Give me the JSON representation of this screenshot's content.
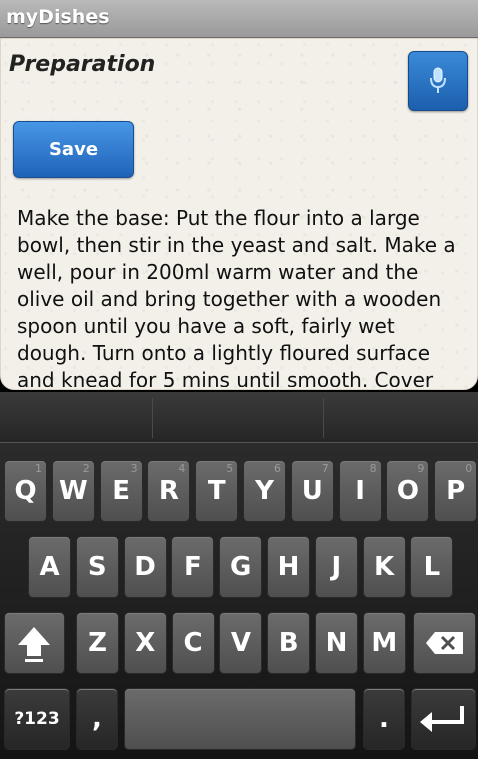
{
  "app": {
    "title": "myDishes"
  },
  "card": {
    "heading": "Preparation",
    "save_label": "Save",
    "text": "Make the base: Put the flour into a large bowl, then stir in the yeast and salt. Make a well, pour in 200ml warm water and the olive oil and bring together with a wooden spoon until you have a soft, fairly wet dough. Turn onto a lightly floured surface and knead for 5 mins until smooth. Cover"
  },
  "keyboard": {
    "row1": [
      {
        "label": "Q",
        "hint": "1"
      },
      {
        "label": "W",
        "hint": "2"
      },
      {
        "label": "E",
        "hint": "3"
      },
      {
        "label": "R",
        "hint": "4"
      },
      {
        "label": "T",
        "hint": "5"
      },
      {
        "label": "Y",
        "hint": "6"
      },
      {
        "label": "U",
        "hint": "7"
      },
      {
        "label": "I",
        "hint": "8"
      },
      {
        "label": "O",
        "hint": "9"
      },
      {
        "label": "P",
        "hint": "0"
      }
    ],
    "row2": [
      "A",
      "S",
      "D",
      "F",
      "G",
      "H",
      "J",
      "K",
      "L"
    ],
    "row3": [
      "Z",
      "X",
      "C",
      "V",
      "B",
      "N",
      "M"
    ],
    "sym_label": "?123",
    "comma_label": ",",
    "period_label": ".",
    "icons": {
      "mic": "microphone-icon",
      "shift": "shift-icon",
      "backspace": "backspace-icon",
      "enter": "enter-icon"
    }
  }
}
